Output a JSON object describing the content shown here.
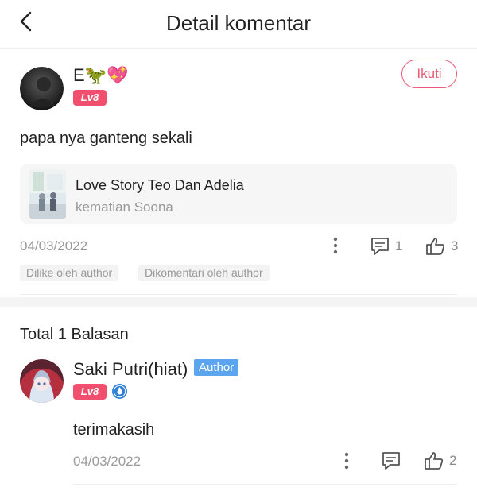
{
  "header": {
    "title": "Detail komentar"
  },
  "comment": {
    "user_name": "E🦖💖",
    "level": "Lv8",
    "follow_label": "Ikuti",
    "text": "papa nya ganteng sekali",
    "book": {
      "title": "Love Story Teo Dan Adelia",
      "chapter": "kematian Soona"
    },
    "date": "04/03/2022",
    "reply_count": "1",
    "like_count": "3",
    "tags": [
      "Dilike oleh author",
      "Dikomentari oleh author"
    ]
  },
  "replies": {
    "total_label": "Total 1 Balasan",
    "items": [
      {
        "user_name": "Saki Putri(hiat)",
        "author_badge": "Author",
        "level": "Lv8",
        "text": "terimakasih",
        "date": "04/03/2022",
        "like_count": "2"
      }
    ]
  },
  "colors": {
    "accent": "#e95a74",
    "level_badge": "#f0506e",
    "author_badge": "#5ba4ee",
    "muted": "#9a9a9a"
  },
  "icons": [
    "back-arrow-icon",
    "more-vertical-icon",
    "comment-icon",
    "thumbs-up-icon",
    "verified-icon"
  ]
}
